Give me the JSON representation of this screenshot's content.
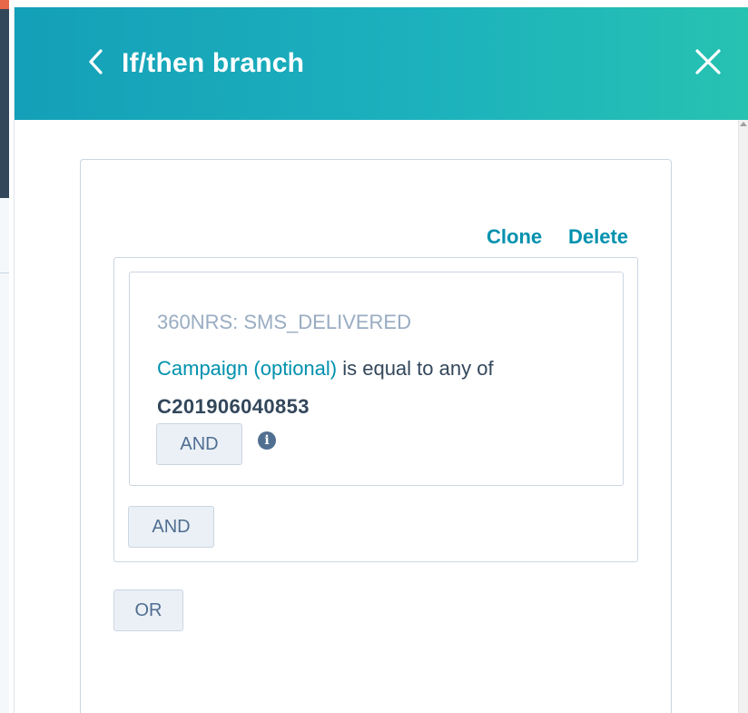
{
  "panel": {
    "title": "If/then branch",
    "back_icon": "chevron-left-icon",
    "close_icon": "close-icon"
  },
  "filter": {
    "clone_label": "Clone",
    "delete_label": "Delete",
    "condition": {
      "event_name": "360NRS: SMS_DELIVERED",
      "property_label": "Campaign (optional)",
      "operator_text": " is equal to any of",
      "value": "C201906040853",
      "and_label": "AND",
      "info_icon": "info-icon"
    },
    "group_and_label": "AND",
    "or_label": "OR"
  },
  "colors": {
    "header_gradient_start": "#14a0b8",
    "header_gradient_end": "#27c2b2",
    "link": "#0091ae",
    "button_bg": "#eaf0f6",
    "muted_text": "#99acc2",
    "body_text": "#33475b"
  }
}
